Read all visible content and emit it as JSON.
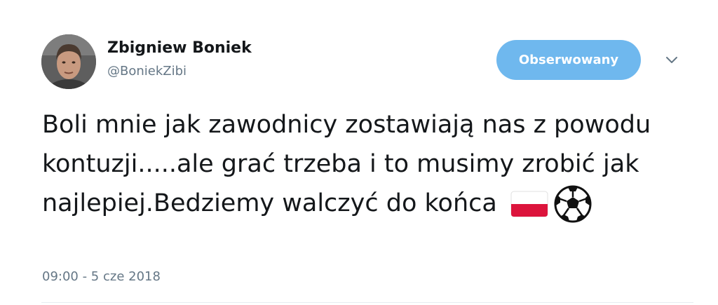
{
  "tweet": {
    "author_name": "Zbigniew Boniek",
    "author_handle": "@BoniekZibi",
    "follow_label": "Obserwowany",
    "text": "Boli mnie jak zawodnicy zostawiają nas z powodu kontuzji.....ale grać trzeba i to musimy zrobić jak najlepiej.Bedziemy walczyć do końca",
    "emojis": [
      "poland-flag-icon",
      "soccer-ball-icon"
    ],
    "timestamp": "09:00 - 5 cze 2018"
  },
  "colors": {
    "follow_button": "#6fb8ee",
    "secondary_text": "#657786",
    "primary_text": "#14171a"
  }
}
